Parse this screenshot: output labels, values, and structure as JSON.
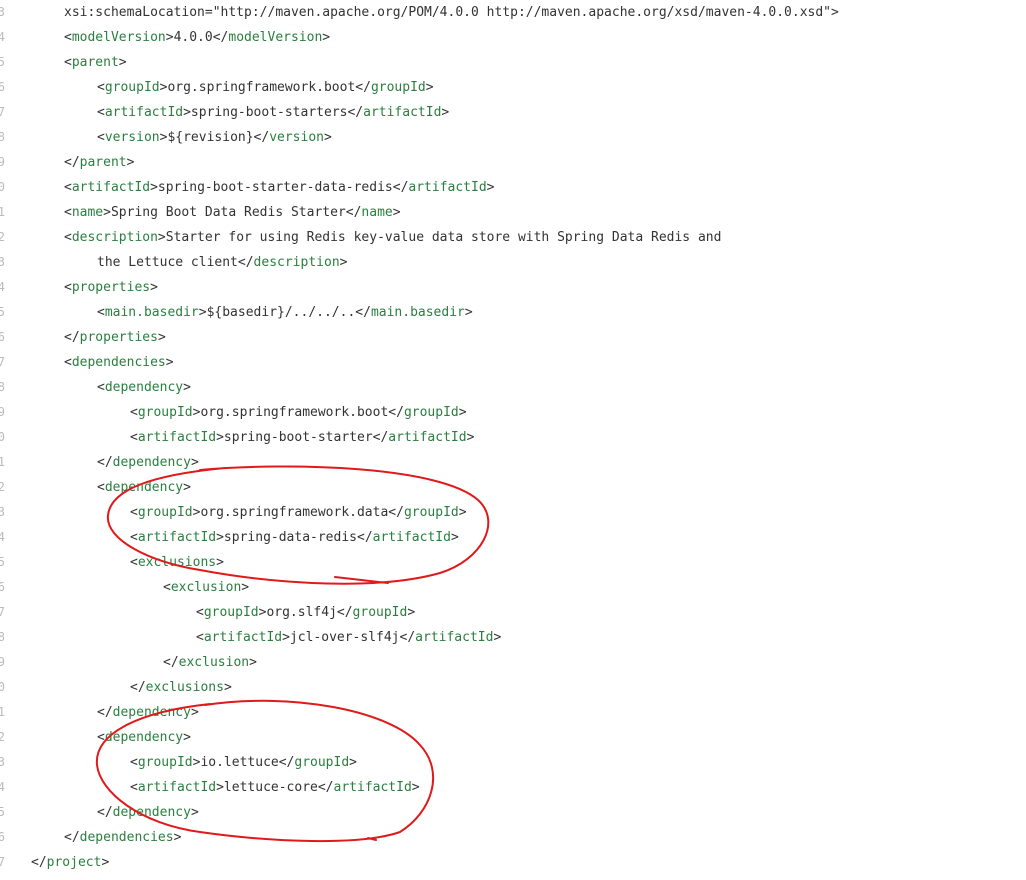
{
  "lines": [
    {
      "num": "3",
      "indent": 1,
      "parts": [
        {
          "t": "xsi:schemaLocation=\"http://maven.apache.org/POM/4.0.0 http://maven.apache.org/xsd/maven-4.0.0.xsd\">",
          "c": "txt"
        }
      ]
    },
    {
      "num": "4",
      "indent": 1,
      "parts": [
        {
          "t": "<",
          "c": "punc"
        },
        {
          "t": "modelVersion",
          "c": "tag"
        },
        {
          "t": ">4.0.0</",
          "c": "punc"
        },
        {
          "t": "modelVersion",
          "c": "tag"
        },
        {
          "t": ">",
          "c": "punc"
        }
      ]
    },
    {
      "num": "5",
      "indent": 1,
      "parts": [
        {
          "t": "<",
          "c": "punc"
        },
        {
          "t": "parent",
          "c": "tag"
        },
        {
          "t": ">",
          "c": "punc"
        }
      ]
    },
    {
      "num": "6",
      "indent": 2,
      "parts": [
        {
          "t": "<",
          "c": "punc"
        },
        {
          "t": "groupId",
          "c": "tag"
        },
        {
          "t": ">org.springframework.boot</",
          "c": "punc"
        },
        {
          "t": "groupId",
          "c": "tag"
        },
        {
          "t": ">",
          "c": "punc"
        }
      ]
    },
    {
      "num": "7",
      "indent": 2,
      "parts": [
        {
          "t": "<",
          "c": "punc"
        },
        {
          "t": "artifactId",
          "c": "tag"
        },
        {
          "t": ">spring-boot-starters</",
          "c": "punc"
        },
        {
          "t": "artifactId",
          "c": "tag"
        },
        {
          "t": ">",
          "c": "punc"
        }
      ]
    },
    {
      "num": "8",
      "indent": 2,
      "parts": [
        {
          "t": "<",
          "c": "punc"
        },
        {
          "t": "version",
          "c": "tag"
        },
        {
          "t": ">${revision}</",
          "c": "punc"
        },
        {
          "t": "version",
          "c": "tag"
        },
        {
          "t": ">",
          "c": "punc"
        }
      ]
    },
    {
      "num": "9",
      "indent": 1,
      "parts": [
        {
          "t": "</",
          "c": "punc"
        },
        {
          "t": "parent",
          "c": "tag"
        },
        {
          "t": ">",
          "c": "punc"
        }
      ]
    },
    {
      "num": "0",
      "indent": 1,
      "parts": [
        {
          "t": "<",
          "c": "punc"
        },
        {
          "t": "artifactId",
          "c": "tag"
        },
        {
          "t": ">spring-boot-starter-data-redis</",
          "c": "punc"
        },
        {
          "t": "artifactId",
          "c": "tag"
        },
        {
          "t": ">",
          "c": "punc"
        }
      ]
    },
    {
      "num": "1",
      "indent": 1,
      "parts": [
        {
          "t": "<",
          "c": "punc"
        },
        {
          "t": "name",
          "c": "tag"
        },
        {
          "t": ">Spring Boot Data Redis Starter</",
          "c": "punc"
        },
        {
          "t": "name",
          "c": "tag"
        },
        {
          "t": ">",
          "c": "punc"
        }
      ]
    },
    {
      "num": "2",
      "indent": 1,
      "parts": [
        {
          "t": "<",
          "c": "punc"
        },
        {
          "t": "description",
          "c": "tag"
        },
        {
          "t": ">Starter for using Redis key-value data store with Spring Data Redis and",
          "c": "punc"
        }
      ]
    },
    {
      "num": "3",
      "indent": 2,
      "parts": [
        {
          "t": "the Lettuce client</",
          "c": "punc"
        },
        {
          "t": "description",
          "c": "tag"
        },
        {
          "t": ">",
          "c": "punc"
        }
      ]
    },
    {
      "num": "4",
      "indent": 1,
      "parts": [
        {
          "t": "<",
          "c": "punc"
        },
        {
          "t": "properties",
          "c": "tag"
        },
        {
          "t": ">",
          "c": "punc"
        }
      ]
    },
    {
      "num": "5",
      "indent": 2,
      "parts": [
        {
          "t": "<",
          "c": "punc"
        },
        {
          "t": "main.basedir",
          "c": "tag"
        },
        {
          "t": ">${basedir}/../../..</",
          "c": "punc"
        },
        {
          "t": "main.basedir",
          "c": "tag"
        },
        {
          "t": ">",
          "c": "punc"
        }
      ]
    },
    {
      "num": "6",
      "indent": 1,
      "parts": [
        {
          "t": "</",
          "c": "punc"
        },
        {
          "t": "properties",
          "c": "tag"
        },
        {
          "t": ">",
          "c": "punc"
        }
      ]
    },
    {
      "num": "7",
      "indent": 1,
      "parts": [
        {
          "t": "<",
          "c": "punc"
        },
        {
          "t": "dependencies",
          "c": "tag"
        },
        {
          "t": ">",
          "c": "punc"
        }
      ]
    },
    {
      "num": "8",
      "indent": 2,
      "parts": [
        {
          "t": "<",
          "c": "punc"
        },
        {
          "t": "dependency",
          "c": "tag"
        },
        {
          "t": ">",
          "c": "punc"
        }
      ]
    },
    {
      "num": "9",
      "indent": 3,
      "parts": [
        {
          "t": "<",
          "c": "punc"
        },
        {
          "t": "groupId",
          "c": "tag"
        },
        {
          "t": ">org.springframework.boot</",
          "c": "punc"
        },
        {
          "t": "groupId",
          "c": "tag"
        },
        {
          "t": ">",
          "c": "punc"
        }
      ]
    },
    {
      "num": "0",
      "indent": 3,
      "parts": [
        {
          "t": "<",
          "c": "punc"
        },
        {
          "t": "artifactId",
          "c": "tag"
        },
        {
          "t": ">spring-boot-starter</",
          "c": "punc"
        },
        {
          "t": "artifactId",
          "c": "tag"
        },
        {
          "t": ">",
          "c": "punc"
        }
      ]
    },
    {
      "num": "1",
      "indent": 2,
      "parts": [
        {
          "t": "</",
          "c": "punc"
        },
        {
          "t": "dependency",
          "c": "tag"
        },
        {
          "t": ">",
          "c": "punc"
        }
      ]
    },
    {
      "num": "2",
      "indent": 2,
      "parts": [
        {
          "t": "<",
          "c": "punc"
        },
        {
          "t": "dependency",
          "c": "tag"
        },
        {
          "t": ">",
          "c": "punc"
        }
      ]
    },
    {
      "num": "3",
      "indent": 3,
      "parts": [
        {
          "t": "<",
          "c": "punc"
        },
        {
          "t": "groupId",
          "c": "tag"
        },
        {
          "t": ">org.springframework.data</",
          "c": "punc"
        },
        {
          "t": "groupId",
          "c": "tag"
        },
        {
          "t": ">",
          "c": "punc"
        }
      ]
    },
    {
      "num": "4",
      "indent": 3,
      "parts": [
        {
          "t": "<",
          "c": "punc"
        },
        {
          "t": "artifactId",
          "c": "tag"
        },
        {
          "t": ">spring-data-redis</",
          "c": "punc"
        },
        {
          "t": "artifactId",
          "c": "tag"
        },
        {
          "t": ">",
          "c": "punc"
        }
      ]
    },
    {
      "num": "5",
      "indent": 3,
      "parts": [
        {
          "t": "<",
          "c": "punc"
        },
        {
          "t": "exclusions",
          "c": "tag"
        },
        {
          "t": ">",
          "c": "punc"
        }
      ]
    },
    {
      "num": "6",
      "indent": 4,
      "parts": [
        {
          "t": "<",
          "c": "punc"
        },
        {
          "t": "exclusion",
          "c": "tag"
        },
        {
          "t": ">",
          "c": "punc"
        }
      ]
    },
    {
      "num": "7",
      "indent": 5,
      "parts": [
        {
          "t": "<",
          "c": "punc"
        },
        {
          "t": "groupId",
          "c": "tag"
        },
        {
          "t": ">org.slf4j</",
          "c": "punc"
        },
        {
          "t": "groupId",
          "c": "tag"
        },
        {
          "t": ">",
          "c": "punc"
        }
      ]
    },
    {
      "num": "8",
      "indent": 5,
      "parts": [
        {
          "t": "<",
          "c": "punc"
        },
        {
          "t": "artifactId",
          "c": "tag"
        },
        {
          "t": ">jcl-over-slf4j</",
          "c": "punc"
        },
        {
          "t": "artifactId",
          "c": "tag"
        },
        {
          "t": ">",
          "c": "punc"
        }
      ]
    },
    {
      "num": "9",
      "indent": 4,
      "parts": [
        {
          "t": "</",
          "c": "punc"
        },
        {
          "t": "exclusion",
          "c": "tag"
        },
        {
          "t": ">",
          "c": "punc"
        }
      ]
    },
    {
      "num": "0",
      "indent": 3,
      "parts": [
        {
          "t": "</",
          "c": "punc"
        },
        {
          "t": "exclusions",
          "c": "tag"
        },
        {
          "t": ">",
          "c": "punc"
        }
      ]
    },
    {
      "num": "1",
      "indent": 2,
      "parts": [
        {
          "t": "</",
          "c": "punc"
        },
        {
          "t": "dependency",
          "c": "tag"
        },
        {
          "t": ">",
          "c": "punc"
        }
      ]
    },
    {
      "num": "2",
      "indent": 2,
      "parts": [
        {
          "t": "<",
          "c": "punc"
        },
        {
          "t": "dependency",
          "c": "tag"
        },
        {
          "t": ">",
          "c": "punc"
        }
      ]
    },
    {
      "num": "3",
      "indent": 3,
      "parts": [
        {
          "t": "<",
          "c": "punc"
        },
        {
          "t": "groupId",
          "c": "tag"
        },
        {
          "t": ">io.lettuce</",
          "c": "punc"
        },
        {
          "t": "groupId",
          "c": "tag"
        },
        {
          "t": ">",
          "c": "punc"
        }
      ]
    },
    {
      "num": "4",
      "indent": 3,
      "parts": [
        {
          "t": "<",
          "c": "punc"
        },
        {
          "t": "artifactId",
          "c": "tag"
        },
        {
          "t": ">lettuce-core</",
          "c": "punc"
        },
        {
          "t": "artifactId",
          "c": "tag"
        },
        {
          "t": ">",
          "c": "punc"
        }
      ]
    },
    {
      "num": "5",
      "indent": 2,
      "parts": [
        {
          "t": "</",
          "c": "punc"
        },
        {
          "t": "dependency",
          "c": "tag"
        },
        {
          "t": ">",
          "c": "punc"
        }
      ]
    },
    {
      "num": "6",
      "indent": 1,
      "parts": [
        {
          "t": "</",
          "c": "punc"
        },
        {
          "t": "dependencies",
          "c": "tag"
        },
        {
          "t": ">",
          "c": "punc"
        }
      ]
    },
    {
      "num": "7",
      "indent": 0,
      "parts": [
        {
          "t": "</",
          "c": "punc"
        },
        {
          "t": "project",
          "c": "tag"
        },
        {
          "t": ">",
          "c": "punc"
        }
      ]
    }
  ],
  "colors": {
    "tag": "#2a7f3f",
    "text": "#333333",
    "gutter": "#bbbbbb",
    "annotation": "#e0191b"
  }
}
